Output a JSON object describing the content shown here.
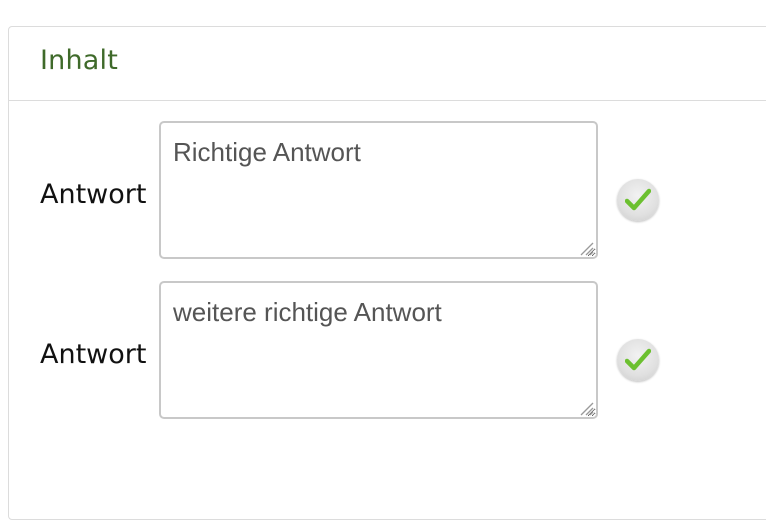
{
  "panel": {
    "title": "Inhalt"
  },
  "answers": [
    {
      "label": "Antwort",
      "value": "Richtige Antwort",
      "status_icon": "check-icon"
    },
    {
      "label": "Antwort",
      "value": "weitere richtige Antwort",
      "status_icon": "check-icon"
    }
  ],
  "colors": {
    "title": "#3f6a2a",
    "check": "#6cc030"
  }
}
